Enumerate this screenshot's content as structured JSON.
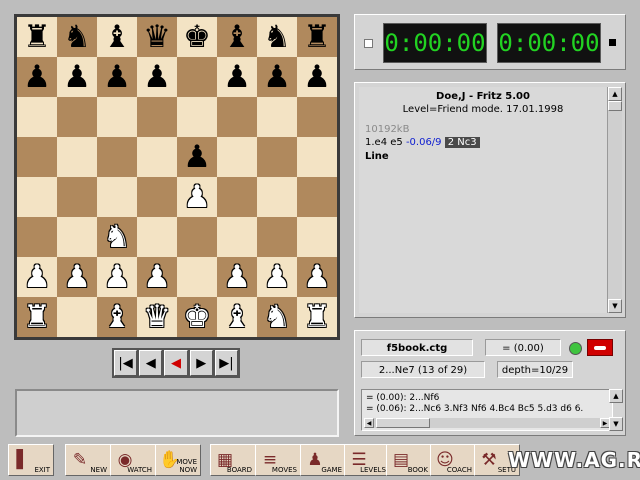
{
  "board": {
    "ranks": [
      [
        "br",
        "bn",
        "bb",
        "bq",
        "bk",
        "bb",
        "bn",
        "br"
      ],
      [
        "bp",
        "bp",
        "bp",
        "bp",
        "",
        "bp",
        "bp",
        "bp"
      ],
      [
        "",
        "",
        "",
        "",
        "",
        "",
        "",
        ""
      ],
      [
        "",
        "",
        "",
        "",
        "bp",
        "",
        "",
        ""
      ],
      [
        "",
        "",
        "",
        "",
        "wp",
        "",
        "",
        ""
      ],
      [
        "",
        "",
        "wn",
        "",
        "",
        "",
        "",
        ""
      ],
      [
        "wp",
        "wp",
        "wp",
        "wp",
        "",
        "wp",
        "wp",
        "wp"
      ],
      [
        "wr",
        "",
        "wb",
        "wq",
        "wk",
        "wb",
        "wn",
        "wr"
      ]
    ],
    "glyphs": {
      "k": "♚",
      "q": "♛",
      "r": "♜",
      "b": "♝",
      "n": "♞",
      "p": "♟"
    }
  },
  "navigation": {
    "first_icon": "skip-to-start-icon",
    "back_icon": "step-back-icon",
    "takeback_icon": "takeback-red-icon",
    "forward_icon": "step-forward-icon",
    "last_icon": "skip-to-end-icon",
    "first": "|◀",
    "back": "◀",
    "takeback": "◀",
    "forward": "▶",
    "last": "▶|"
  },
  "clocks": {
    "white_time": "0:00:00",
    "black_time": "0:00:00"
  },
  "analysis": {
    "players": "Doe,J - Fritz 5.00",
    "level_info": "Level=Friend mode.  17.01.1998",
    "memory": "10192kB",
    "moves": "1.e4   e5 ",
    "eval": "-0.06/9",
    "current_move": "2 Nc3",
    "line_label": "Line"
  },
  "book": {
    "file": "f5book.ctg",
    "eval": "= (0.00)",
    "move_info": "2...Ne7 (13 of 29)",
    "depth": "depth=10/29",
    "line1": "= (0.00): 2...Nf6",
    "line2": "= (0.06): 2...Nc6 3.Nf3 Nf6 4.Bc4 Bc5 5.d3 d6 6."
  },
  "toolbar": {
    "items": [
      {
        "label": "EXIT",
        "icon": "exit-door-icon",
        "glyph": "▌"
      },
      {
        "label": "NEW",
        "icon": "new-game-icon",
        "glyph": "✎"
      },
      {
        "label": "WATCH",
        "icon": "watch-eye-icon",
        "glyph": "◉"
      },
      {
        "label": "MOVE\nNOW",
        "icon": "move-now-icon",
        "glyph": "✋"
      },
      {
        "label": "BOARD",
        "icon": "board-icon",
        "glyph": "▦"
      },
      {
        "label": "MOVES",
        "icon": "moves-icon",
        "glyph": "≡"
      },
      {
        "label": "GAME",
        "icon": "game-icon",
        "glyph": "♟"
      },
      {
        "label": "LEVELS",
        "icon": "levels-icon",
        "glyph": "☰"
      },
      {
        "label": "BOOK",
        "icon": "book-icon",
        "glyph": "▤"
      },
      {
        "label": "COACH",
        "icon": "coach-icon",
        "glyph": "☺"
      },
      {
        "label": "SETU",
        "icon": "setup-icon",
        "glyph": "⚒"
      },
      {
        "label": "",
        "icon": "extra-icon-1",
        "glyph": ""
      },
      {
        "label": "",
        "icon": "extra-icon-2",
        "glyph": ""
      }
    ]
  },
  "watermark": "WWW.AG.RU"
}
